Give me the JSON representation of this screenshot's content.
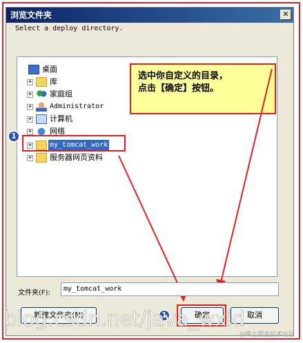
{
  "window": {
    "title": "浏览文件夹",
    "close_glyph": "✕"
  },
  "instruction": "Select a deploy directory.",
  "tree": {
    "items": [
      {
        "label": "桌面",
        "icon": "desktop-icon",
        "expandable": false
      },
      {
        "label": "库",
        "icon": "library-icon",
        "expandable": true
      },
      {
        "label": "家庭组",
        "icon": "homegroup-icon",
        "expandable": true
      },
      {
        "label": "Administrator",
        "icon": "user-icon",
        "expandable": true
      },
      {
        "label": "计算机",
        "icon": "computer-icon",
        "expandable": true
      },
      {
        "label": "网络",
        "icon": "network-icon",
        "expandable": true
      },
      {
        "label": "my_tomcat_work",
        "icon": "folder-icon",
        "expandable": true,
        "selected": true
      },
      {
        "label": "服务器网页资料",
        "icon": "folder-icon",
        "expandable": true
      }
    ],
    "expand_glyph": "+"
  },
  "callout": {
    "line1": "选中你自定义的目录，",
    "line2": "点击【确定】按钮。"
  },
  "badges": {
    "first": "1",
    "second": "1"
  },
  "folder": {
    "label": "文件夹(F):",
    "value": "my_tomcat_work"
  },
  "buttons": {
    "new_folder": "新建文件夹(N)",
    "ok": "确定",
    "cancel": "取消"
  },
  "watermark": {
    "main": "blog.csdn.net/java_wxid",
    "small": "@稀土掘金技术社区"
  },
  "colors": {
    "annotation_red": "#e02020",
    "selection_blue": "#316ac5",
    "callout_yellow": "#ffff99"
  }
}
